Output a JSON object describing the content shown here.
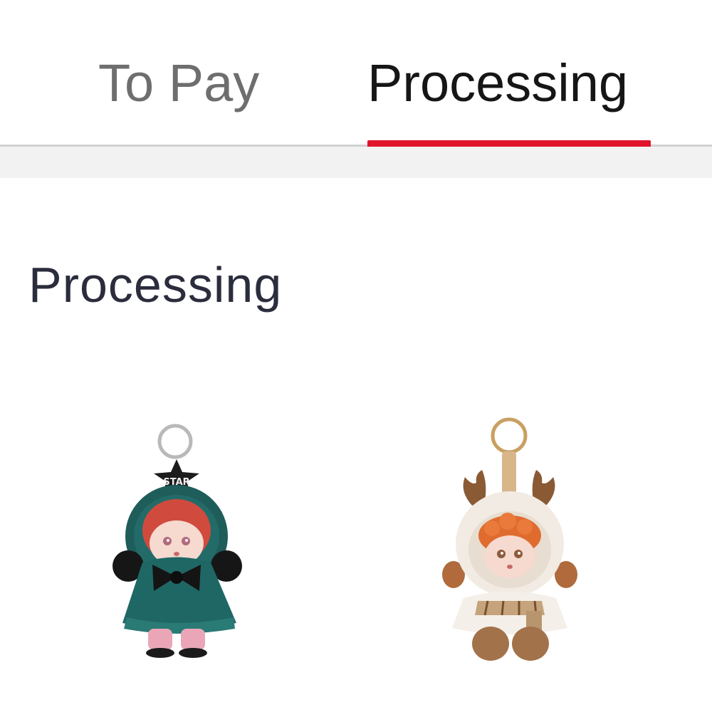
{
  "tabs": [
    {
      "label": "To Pay",
      "active": false
    },
    {
      "label": "Processing",
      "active": true
    }
  ],
  "accent_color": "#e0142a",
  "section": {
    "title": "Processing"
  },
  "products": [
    {
      "icon": "green-star-doll-keychain-image",
      "hat_text": "STAR"
    },
    {
      "icon": "reindeer-doll-keychain-image"
    }
  ]
}
